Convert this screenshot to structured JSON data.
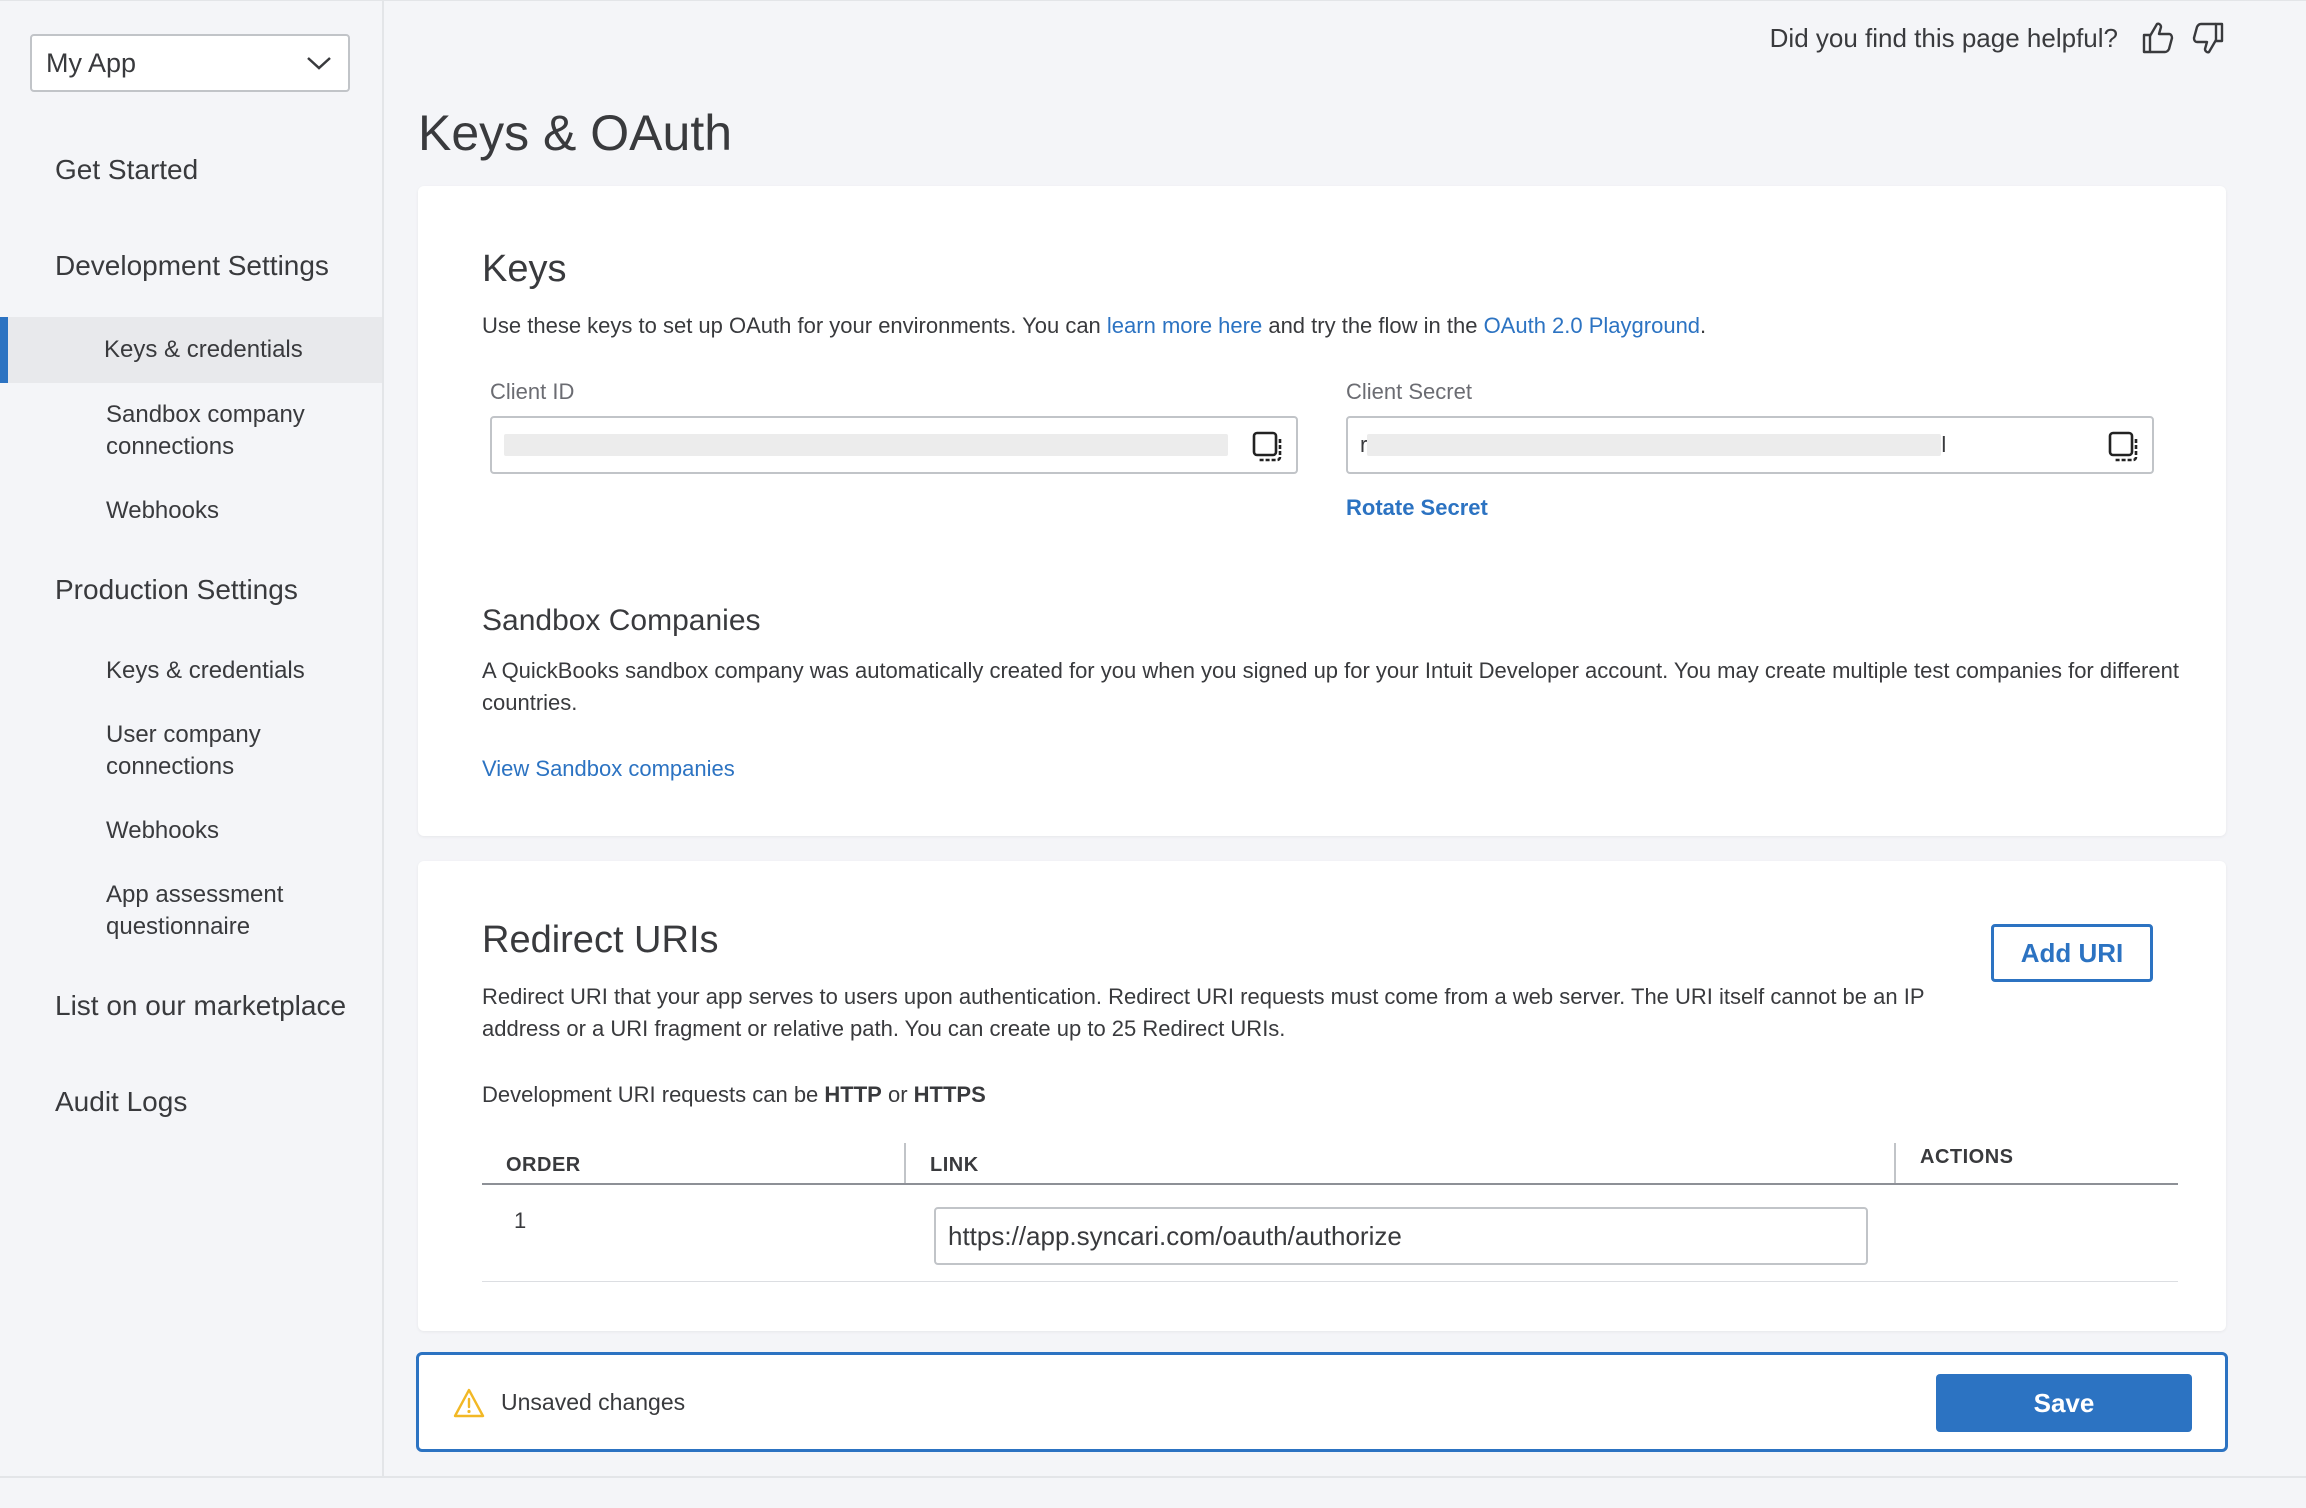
{
  "sidebar": {
    "app_selector": {
      "value": "My App",
      "icon": "chevron-down-icon"
    },
    "get_started": "Get Started",
    "development_settings": {
      "title": "Development Settings",
      "items": [
        "Keys & credentials",
        "Sandbox company connections",
        "Webhooks"
      ]
    },
    "production_settings": {
      "title": "Production Settings",
      "items": [
        "Keys & credentials",
        "User company connections",
        "Webhooks",
        "App assessment questionnaire"
      ]
    },
    "marketplace": "List on our marketplace",
    "audit_logs": "Audit Logs",
    "active_item": "Development Settings / Keys & credentials"
  },
  "header": {
    "helpful_question": "Did you find this page helpful?",
    "thumbs_up_icon": "thumbs-up-icon",
    "thumbs_down_icon": "thumbs-down-icon"
  },
  "page_title": "Keys & OAuth",
  "keys": {
    "title": "Keys",
    "desc_before": "Use these keys to set up OAuth for your environments. You can ",
    "learn_more_link": "learn more here",
    "desc_middle": " and try the flow in the ",
    "playground_link": "OAuth 2.0 Playground",
    "desc_end": ".",
    "client_id_label": "Client ID",
    "client_secret_label": "Client Secret",
    "client_secret_prefix": "r",
    "client_secret_suffix": "l",
    "rotate_secret": "Rotate Secret",
    "copy_icon": "copy-icon"
  },
  "sandbox": {
    "title": "Sandbox Companies",
    "desc": "A QuickBooks sandbox company was automatically created for you when you signed up for your Intuit Developer account. You may create multiple test companies for different countries.",
    "view_link": "View Sandbox companies"
  },
  "redirect": {
    "title": "Redirect URIs",
    "add_button": "Add URI",
    "desc": "Redirect URI that your app serves to users upon authentication. Redirect URI requests must come from a web server. The URI itself cannot be an IP address or a URI fragment or relative path. You can create up to 25 Redirect URIs.",
    "dev_note_before": "Development URI requests can be ",
    "dev_note_http": "HTTP",
    "dev_note_or": " or ",
    "dev_note_https": "HTTPS",
    "columns": [
      "ORDER",
      "LINK",
      "ACTIONS"
    ],
    "rows": [
      {
        "order": "1",
        "link": "https://app.syncari.com/oauth/authorize"
      }
    ]
  },
  "savebar": {
    "warning_icon": "warning-icon",
    "message": "Unsaved changes",
    "save_button": "Save"
  },
  "colors": {
    "accent": "#2c73c2",
    "text": "#393a3d",
    "background": "#f4f5f8",
    "warning": "#f2b825"
  }
}
